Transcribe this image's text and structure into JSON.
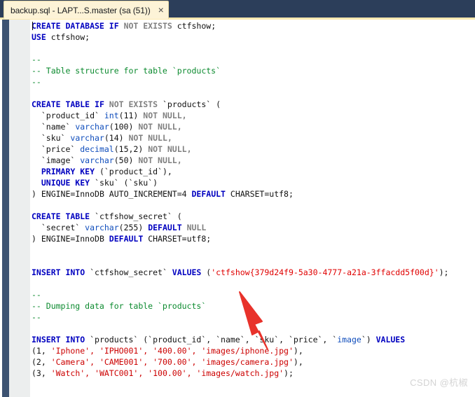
{
  "window": {
    "titlebar_color": "#2c3e5a",
    "accent_color": "#fde9b0"
  },
  "tab": {
    "label": "backup.sql - LAPT...S.master (sa (51))",
    "close_glyph": "×"
  },
  "editor": {
    "rail_color": "#3d5372",
    "gutter_color": "#eceeee",
    "background": "#ffffff",
    "colors": {
      "keyword": "#0000c0",
      "keyword_gray": "#808080",
      "type": "#0f4dbc",
      "comment": "#0b8a2e",
      "string": "#cc0000",
      "plain": "#111111"
    },
    "lines": [
      {
        "id": 1,
        "segments": [
          {
            "t": "CREATE DATABASE ",
            "c": "kw"
          },
          {
            "t": "IF ",
            "c": "kw"
          },
          {
            "t": "NOT EXISTS ",
            "c": "kwg"
          },
          {
            "t": "ctfshow;",
            "c": "pln"
          }
        ]
      },
      {
        "id": 2,
        "segments": [
          {
            "t": "USE ",
            "c": "kw"
          },
          {
            "t": "ctfshow;",
            "c": "pln"
          }
        ]
      },
      {
        "id": 3,
        "segments": []
      },
      {
        "id": 4,
        "segments": [
          {
            "t": "--",
            "c": "cmt"
          }
        ]
      },
      {
        "id": 5,
        "segments": [
          {
            "t": "-- Table structure for table `products`",
            "c": "cmt"
          }
        ]
      },
      {
        "id": 6,
        "segments": [
          {
            "t": "--",
            "c": "cmt"
          }
        ]
      },
      {
        "id": 7,
        "segments": []
      },
      {
        "id": 8,
        "segments": [
          {
            "t": "CREATE TABLE ",
            "c": "kw"
          },
          {
            "t": "IF ",
            "c": "kw"
          },
          {
            "t": "NOT EXISTS ",
            "c": "kwg"
          },
          {
            "t": "`products` (",
            "c": "pln"
          }
        ]
      },
      {
        "id": 9,
        "segments": [
          {
            "t": "  `product_id` ",
            "c": "pln"
          },
          {
            "t": "int",
            "c": "typ"
          },
          {
            "t": "(11) ",
            "c": "pln"
          },
          {
            "t": "NOT NULL,",
            "c": "kwg"
          }
        ]
      },
      {
        "id": 10,
        "segments": [
          {
            "t": "  `name` ",
            "c": "pln"
          },
          {
            "t": "varchar",
            "c": "typ"
          },
          {
            "t": "(100) ",
            "c": "pln"
          },
          {
            "t": "NOT NULL,",
            "c": "kwg"
          }
        ]
      },
      {
        "id": 11,
        "segments": [
          {
            "t": "  `sku` ",
            "c": "pln"
          },
          {
            "t": "varchar",
            "c": "typ"
          },
          {
            "t": "(14) ",
            "c": "pln"
          },
          {
            "t": "NOT NULL,",
            "c": "kwg"
          }
        ]
      },
      {
        "id": 12,
        "segments": [
          {
            "t": "  `price` ",
            "c": "pln"
          },
          {
            "t": "decimal",
            "c": "typ"
          },
          {
            "t": "(15,2) ",
            "c": "pln"
          },
          {
            "t": "NOT NULL,",
            "c": "kwg"
          }
        ]
      },
      {
        "id": 13,
        "segments": [
          {
            "t": "  `image` ",
            "c": "pln"
          },
          {
            "t": "varchar",
            "c": "typ"
          },
          {
            "t": "(50) ",
            "c": "pln"
          },
          {
            "t": "NOT NULL,",
            "c": "kwg"
          }
        ]
      },
      {
        "id": 14,
        "segments": [
          {
            "t": "  PRIMARY KEY ",
            "c": "kw"
          },
          {
            "t": "(`product_id`),",
            "c": "pln"
          }
        ]
      },
      {
        "id": 15,
        "segments": [
          {
            "t": "  UNIQUE KEY ",
            "c": "kw"
          },
          {
            "t": "`sku` (`sku`)",
            "c": "pln"
          }
        ]
      },
      {
        "id": 16,
        "segments": [
          {
            "t": ") ",
            "c": "pln"
          },
          {
            "t": "ENGINE",
            "c": "pln"
          },
          {
            "t": "=InnoDB AUTO_INCREMENT=4 ",
            "c": "pln"
          },
          {
            "t": "DEFAULT ",
            "c": "kw"
          },
          {
            "t": "CHARSET=utf8;",
            "c": "pln"
          }
        ]
      },
      {
        "id": 17,
        "segments": []
      },
      {
        "id": 18,
        "segments": [
          {
            "t": "CREATE TABLE ",
            "c": "kw"
          },
          {
            "t": "`ctfshow_secret` (",
            "c": "pln"
          }
        ]
      },
      {
        "id": 19,
        "segments": [
          {
            "t": "  `secret` ",
            "c": "pln"
          },
          {
            "t": "varchar",
            "c": "typ"
          },
          {
            "t": "(255) ",
            "c": "pln"
          },
          {
            "t": "DEFAULT ",
            "c": "kw"
          },
          {
            "t": "NULL",
            "c": "kwg"
          }
        ]
      },
      {
        "id": 20,
        "segments": [
          {
            "t": ") ",
            "c": "pln"
          },
          {
            "t": "ENGINE=InnoDB ",
            "c": "pln"
          },
          {
            "t": "DEFAULT ",
            "c": "kw"
          },
          {
            "t": "CHARSET=utf8;",
            "c": "pln"
          }
        ]
      },
      {
        "id": 21,
        "segments": []
      },
      {
        "id": 22,
        "segments": []
      },
      {
        "id": 23,
        "segments": [
          {
            "t": "INSERT INTO ",
            "c": "kw"
          },
          {
            "t": "`ctfshow_secret` ",
            "c": "pln"
          },
          {
            "t": "VALUES ",
            "c": "kw"
          },
          {
            "t": "(",
            "c": "pln"
          },
          {
            "t": "'ctfshow{379d24f9-5a30-4777-a21a-3ffacdd5f00d}'",
            "c": "strh"
          },
          {
            "t": ");",
            "c": "pln"
          }
        ]
      },
      {
        "id": 24,
        "segments": []
      },
      {
        "id": 25,
        "segments": [
          {
            "t": "--",
            "c": "cmt"
          }
        ]
      },
      {
        "id": 26,
        "segments": [
          {
            "t": "-- Dumping data for table `products`",
            "c": "cmt"
          }
        ]
      },
      {
        "id": 27,
        "segments": [
          {
            "t": "--",
            "c": "cmt"
          }
        ]
      },
      {
        "id": 28,
        "segments": []
      },
      {
        "id": 29,
        "segments": [
          {
            "t": "INSERT INTO ",
            "c": "kw"
          },
          {
            "t": "`products` (`product_id`, `name`, `sku`, `price`, `",
            "c": "pln"
          },
          {
            "t": "image",
            "c": "typ"
          },
          {
            "t": "`) ",
            "c": "pln"
          },
          {
            "t": "VALUES",
            "c": "kw"
          }
        ]
      },
      {
        "id": 30,
        "segments": [
          {
            "t": "(1, ",
            "c": "pln"
          },
          {
            "t": "'Iphone', 'IPHO001', '400.00', 'images/iphone.jpg'",
            "c": "str"
          },
          {
            "t": "),",
            "c": "pln"
          }
        ]
      },
      {
        "id": 31,
        "segments": [
          {
            "t": "(2, ",
            "c": "pln"
          },
          {
            "t": "'Camera', 'CAME001', '700.00', 'images/camera.jpg'",
            "c": "str"
          },
          {
            "t": "),",
            "c": "pln"
          }
        ]
      },
      {
        "id": 32,
        "segments": [
          {
            "t": "(3, ",
            "c": "pln"
          },
          {
            "t": "'Watch', 'WATC001', '100.00', 'images/watch.jpg'",
            "c": "str"
          },
          {
            "t": ");",
            "c": "pln"
          }
        ]
      }
    ]
  },
  "sql_content": {
    "database": "ctfshow",
    "tables": [
      {
        "name": "products",
        "columns": [
          {
            "name": "product_id",
            "type": "int(11)",
            "constraint": "NOT NULL"
          },
          {
            "name": "name",
            "type": "varchar(100)",
            "constraint": "NOT NULL"
          },
          {
            "name": "sku",
            "type": "varchar(14)",
            "constraint": "NOT NULL"
          },
          {
            "name": "price",
            "type": "decimal(15,2)",
            "constraint": "NOT NULL"
          },
          {
            "name": "image",
            "type": "varchar(50)",
            "constraint": "NOT NULL"
          }
        ],
        "primary_key": "product_id",
        "unique_key": "sku",
        "engine": "InnoDB",
        "auto_increment": "4",
        "charset": "utf8"
      },
      {
        "name": "ctfshow_secret",
        "columns": [
          {
            "name": "secret",
            "type": "varchar(255)",
            "constraint": "DEFAULT NULL"
          }
        ],
        "engine": "InnoDB",
        "charset": "utf8"
      }
    ],
    "secret_value": "ctfshow{379d24f9-5a30-4777-a21a-3ffacdd5f00d}",
    "products_rows": [
      {
        "product_id": "1",
        "name": "Iphone",
        "sku": "IPHO001",
        "price": "400.00",
        "image": "images/iphone.jpg"
      },
      {
        "product_id": "2",
        "name": "Camera",
        "sku": "CAME001",
        "price": "700.00",
        "image": "images/camera.jpg"
      },
      {
        "product_id": "3",
        "name": "Watch",
        "sku": "WATC001",
        "price": "100.00",
        "image": "images/watch.jpg"
      }
    ]
  },
  "annotation": {
    "arrow_color": "#e8322b",
    "arrow_target": "secret-value-string"
  },
  "watermark": {
    "text": "CSDN @杭椒"
  }
}
